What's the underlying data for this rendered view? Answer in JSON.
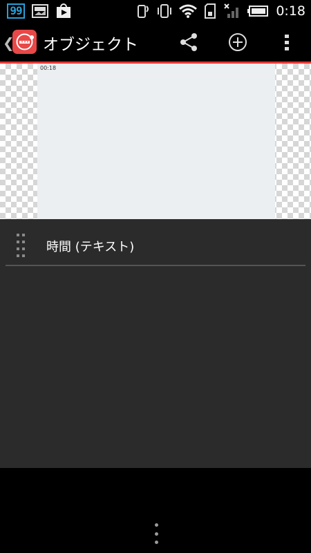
{
  "status_bar": {
    "badge": "99",
    "time": "0:18",
    "icons": [
      "news-icon",
      "play-store-icon",
      "phone-sync-icon",
      "vibrate-icon",
      "wifi-icon",
      "sd-card-icon",
      "signal-off-icon",
      "battery-icon"
    ]
  },
  "action_bar": {
    "title": "オブジェクト",
    "icons": [
      "up-caret-icon",
      "app-logo-icon",
      "share-icon",
      "add-icon",
      "overflow-menu-icon"
    ],
    "accent_color": "#e53935"
  },
  "preview": {
    "time_label": "00:18"
  },
  "object_list": {
    "items": [
      {
        "label": "時間 (テキスト)"
      }
    ]
  },
  "bottom_nav": {
    "icons": [
      "overflow-menu-icon"
    ]
  }
}
